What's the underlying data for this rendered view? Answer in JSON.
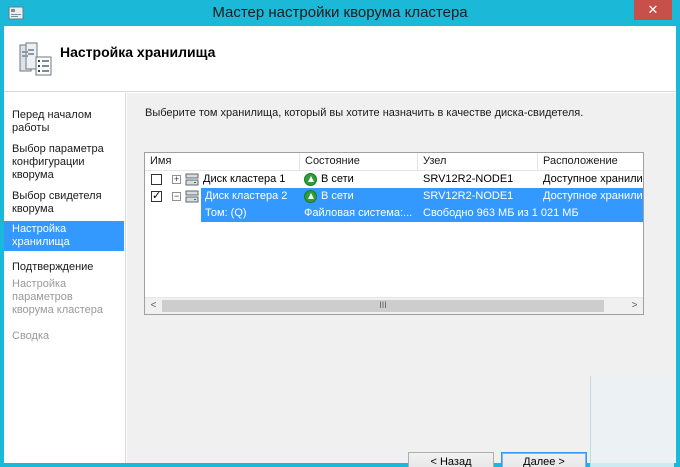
{
  "window": {
    "title": "Мастер настройки кворума кластера",
    "close_glyph": "✕",
    "title_icon": "wizard-icon"
  },
  "header": {
    "title": "Настройка хранилища",
    "icon": "storage-wizard-icon"
  },
  "sidebar": {
    "items": [
      {
        "label": "Перед началом работы",
        "state": "normal"
      },
      {
        "label": "Выбор параметра конфигурации кворума",
        "state": "normal"
      },
      {
        "label": "Выбор свидетеля кворума",
        "state": "normal"
      },
      {
        "label": "Настройка хранилища",
        "state": "active"
      },
      {
        "label": "Подтверждение",
        "state": "normal"
      },
      {
        "label": "Настройка параметров кворума кластера",
        "state": "disabled"
      },
      {
        "label": "Сводка",
        "state": "disabled"
      }
    ]
  },
  "main": {
    "instruction": "Выберите том хранилища, который вы хотите назначить в качестве диска-свидетеля.",
    "table": {
      "columns": [
        "Имя",
        "Состояние",
        "Узел",
        "Расположение"
      ],
      "rows": [
        {
          "checked": false,
          "expander": "+",
          "name": "Диск кластера 1",
          "status": "В сети",
          "node": "SRV12R2-NODE1",
          "location": "Доступное хранили",
          "selected": false
        },
        {
          "checked": true,
          "expander": "−",
          "name": "Диск кластера 2",
          "status": "В сети",
          "node": "SRV12R2-NODE1",
          "location": "Доступное хранили",
          "selected": true
        }
      ],
      "subrow": {
        "volume": "Том: (Q)",
        "filesystem": "Файловая система:...",
        "free": "Свободно 963 МБ из 1 021 МБ"
      },
      "scroll_left": "<",
      "scroll_right": ">",
      "scroll_grip": "III"
    }
  },
  "buttons": {
    "back": "< Назад",
    "next": "Далее >"
  },
  "colors": {
    "titlebar": "#1cb8d8",
    "selection": "#3399ff",
    "close": "#c7504a"
  }
}
